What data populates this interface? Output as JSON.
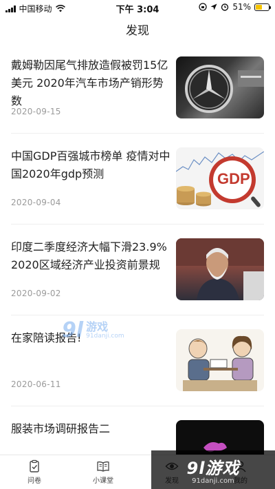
{
  "status": {
    "carrier": "中国移动",
    "time": "下午 3:04",
    "battery": "51%",
    "battery_level": 0.51
  },
  "header": {
    "title": "发现"
  },
  "articles": [
    {
      "title": "戴姆勒因尾气排放造假被罚15亿美元 2020年汽车市场产销形势数",
      "date": "2020-09-15",
      "image": "mercedes-logo-photo"
    },
    {
      "title": "中国GDP百强城市榜单 疫情对中国2020年gdp预测",
      "date": "2020-09-04",
      "image": "gdp-coins-photo",
      "image_text": "GDP"
    },
    {
      "title": "印度二季度经济大幅下滑23.9% 2020区域经济产业投资前景规",
      "date": "2020-09-02",
      "image": "speaker-photo"
    },
    {
      "title": "在家陪读报告!",
      "date": "2020-06-11",
      "image": "family-illustration"
    },
    {
      "title": "服装市场调研报告二",
      "date": "",
      "image": "dark-photo"
    }
  ],
  "watermark": {
    "logo": "9l",
    "name": "游戏",
    "url": "91danji.com"
  },
  "tabs": [
    {
      "label": "问卷",
      "icon": "clipboard-check-icon"
    },
    {
      "label": "小课堂",
      "icon": "open-book-icon"
    },
    {
      "label": "发现",
      "icon": "eye-icon"
    },
    {
      "label": "我的",
      "icon": "user-icon"
    }
  ],
  "corner_watermark": {
    "logo": "9l游戏",
    "url": "91danji.com"
  }
}
